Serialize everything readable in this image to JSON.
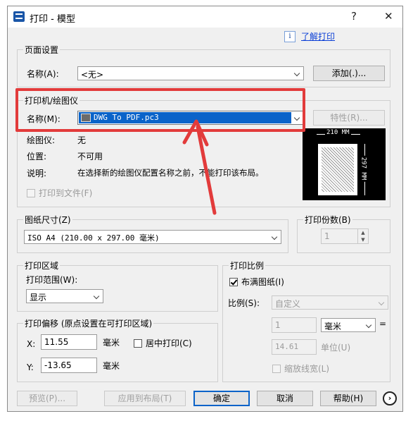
{
  "window": {
    "title": "打印 - 模型",
    "help": "?",
    "close": "✕"
  },
  "help_link": "了解打印",
  "page_setup": {
    "group": "页面设置",
    "name_label": "名称(A):",
    "name_value": "<无>",
    "add_button": "添加(.)..."
  },
  "printer": {
    "group": "打印机/绘图仪",
    "name_label": "名称(M):",
    "name_value": "DWG To PDF.pc3",
    "properties_button": "特性(R)...",
    "plotter_label": "绘图仪:",
    "plotter_value": "无",
    "location_label": "位置:",
    "location_value": "不可用",
    "desc_label": "说明:",
    "desc_value": "在选择新的绘图仪配置名称之前，不能打印该布局。",
    "print_to_file": "打印到文件(F)",
    "preview_width": "210 MM",
    "preview_height": "297 MM"
  },
  "paper_size": {
    "group": "图纸尺寸(Z)",
    "value": "ISO A4 (210.00 x 297.00 毫米)"
  },
  "copies": {
    "group": "打印份数(B)",
    "value": "1"
  },
  "plot_area": {
    "group": "打印区域",
    "range_label": "打印范围(W):",
    "range_value": "显示"
  },
  "plot_offset": {
    "group": "打印偏移 (原点设置在可打印区域)",
    "x_label": "X:",
    "x_value": "11.55",
    "x_unit": "毫米",
    "center": "居中打印(C)",
    "y_label": "Y:",
    "y_value": "-13.65",
    "y_unit": "毫米"
  },
  "plot_scale": {
    "group": "打印比例",
    "fit": "布满图纸(I)",
    "ratio_label": "比例(S):",
    "ratio_value": "自定义",
    "num_value": "1",
    "unit_value": "毫米",
    "equals": "=",
    "den_value": "14.61",
    "den_unit": "单位(U)",
    "lineweight": "缩放线宽(L)"
  },
  "buttons": {
    "preview": "预览(P)...",
    "apply": "应用到布局(T)",
    "ok": "确定",
    "cancel": "取消",
    "help": "帮助(H)"
  },
  "colors": {
    "highlight_red": "#e23b3b",
    "selection_blue": "#0a63c9",
    "link_blue": "#0b3fd6"
  }
}
